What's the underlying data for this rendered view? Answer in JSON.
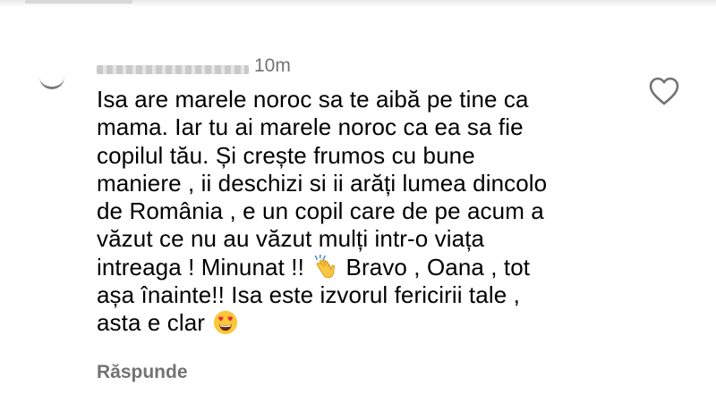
{
  "comment": {
    "username": "username",
    "time": "10m",
    "lines": [
      "Isa are marele noroc sa te aibă pe tine ca",
      "mama. Iar tu ai marele noroc ca ea sa fie",
      "copilul tău. Și crește frumos cu bune",
      "maniere , ii deschizi si ii arăți lumea dincolo",
      "de România , e un copil care de pe acum a",
      "văzut ce nu au văzut mulți intr-o viața"
    ],
    "line7_before": "intreaga ! Minunat !! ",
    "line7_after": " Bravo , Oana , tot",
    "line8": "așa înainte!! Isa este izvorul fericirii tale ,",
    "line9_before": "asta e clar ",
    "emoji_1": "clapping-hands-emoji",
    "emoji_2": "heart-eyes-emoji",
    "reply_label": "Răspunde",
    "like_icon": "heart-outline-icon"
  }
}
